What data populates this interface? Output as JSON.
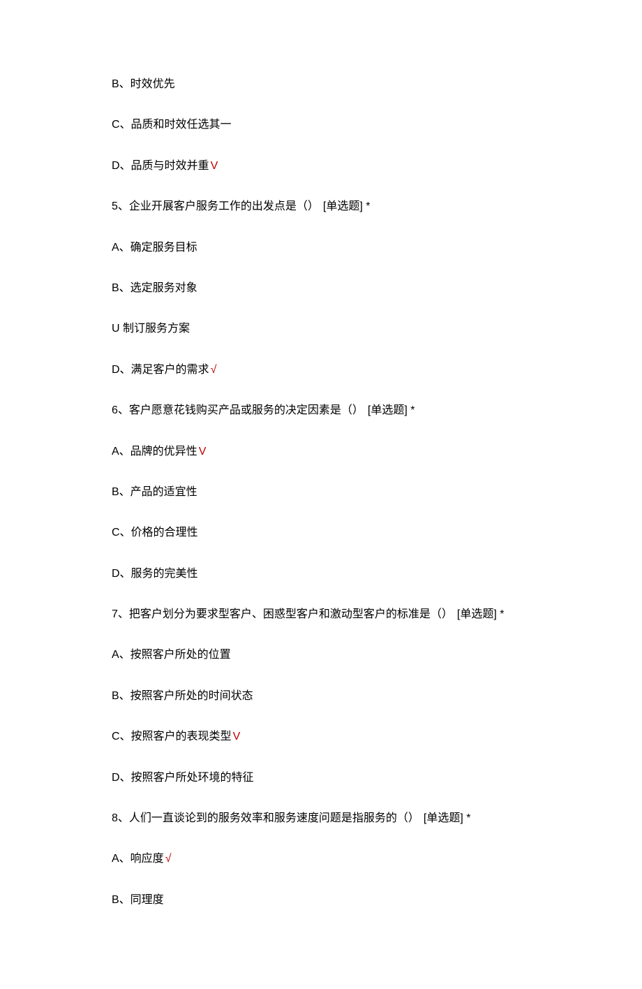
{
  "q4": {
    "b": "B、时效优先",
    "c": "C、品质和时效任选其一",
    "d": "D、品质与时效并重",
    "d_mark": "V"
  },
  "q5": {
    "stem": "5、企业开展客户服务工作的出发点是（）",
    "tag": "[单选题]  *",
    "a": "A、确定服务目标",
    "b": "B、选定服务对象",
    "c": "U 制订服务方案",
    "d": "D、满足客户的需求",
    "d_mark": "√"
  },
  "q6": {
    "stem": "6、客户愿意花钱购买产品或服务的决定因素是（）",
    "tag": "[单选题]  *",
    "a": "A、品牌的优异性",
    "a_mark": "V",
    "b": "B、产品的适宜性",
    "c": "C、价格的合理性",
    "d": "D、服务的完美性"
  },
  "q7": {
    "stem": "7、把客户划分为要求型客户、困惑型客户和激动型客户的标准是（）",
    "tag": "[单选题]  *",
    "a": "A、按照客户所处的位置",
    "b": "B、按照客户所处的时间状态",
    "c": "C、按照客户的表现类型",
    "c_mark": "V",
    "d": "D、按照客户所处环境的特征"
  },
  "q8": {
    "stem": "8、人们一直谈论到的服务效率和服务速度问题是指服务的（）",
    "tag": "[单选题]  *",
    "a": "A、响应度",
    "a_mark": "√",
    "b": "B、同理度"
  }
}
